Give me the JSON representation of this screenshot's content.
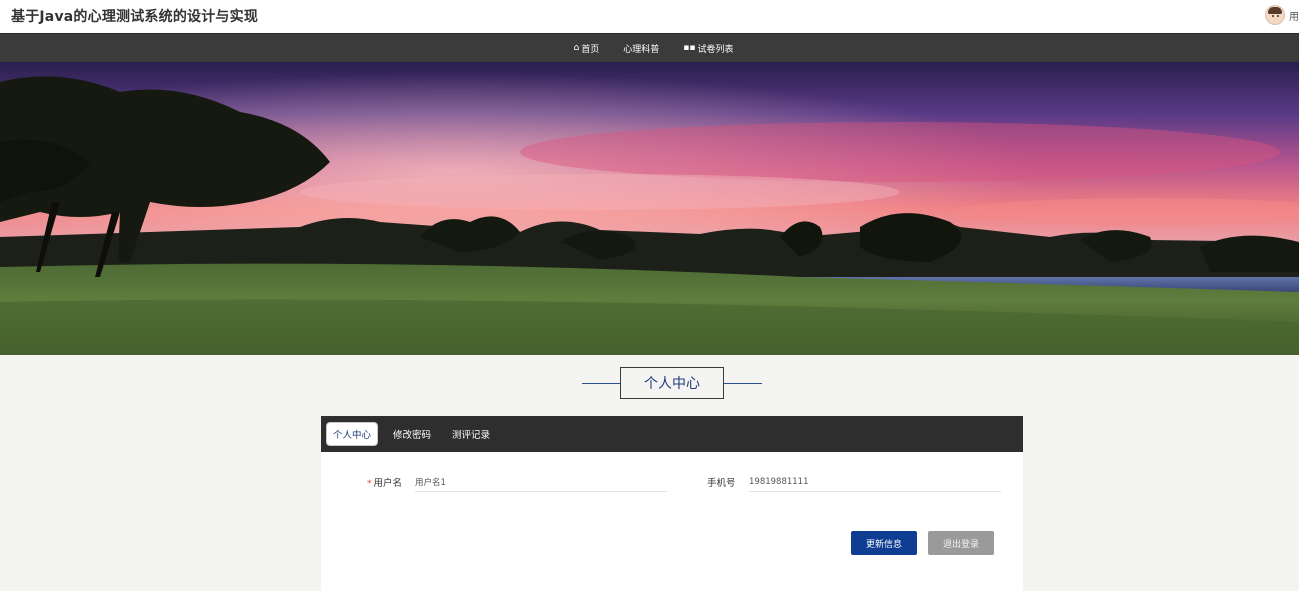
{
  "header": {
    "site_title": "基于Java的心理测试系统的设计与实现",
    "user_label": "用"
  },
  "nav": {
    "items": [
      {
        "icon": "home-icon",
        "glyph": "⌂",
        "label": "首页"
      },
      {
        "icon": "none",
        "glyph": "",
        "label": "心理科普"
      },
      {
        "icon": "grid-icon",
        "glyph": "▪▪",
        "label": "试卷列表"
      }
    ]
  },
  "section": {
    "title": "个人中心"
  },
  "tabs": [
    {
      "label": "个人中心",
      "active": true
    },
    {
      "label": "修改密码",
      "active": false
    },
    {
      "label": "测评记录",
      "active": false
    }
  ],
  "form": {
    "username": {
      "label": "用户名",
      "required_mark": "*",
      "value": "用户名1"
    },
    "phone": {
      "label": "手机号",
      "value": "19819881111"
    }
  },
  "buttons": {
    "update": "更新信息",
    "logout": "退出登录"
  },
  "colors": {
    "nav_bg": "#3b3b3b",
    "tab_bar_bg": "#2f2e2e",
    "accent_blue": "#0f3d91",
    "logout_gray": "#9a9a9a"
  }
}
